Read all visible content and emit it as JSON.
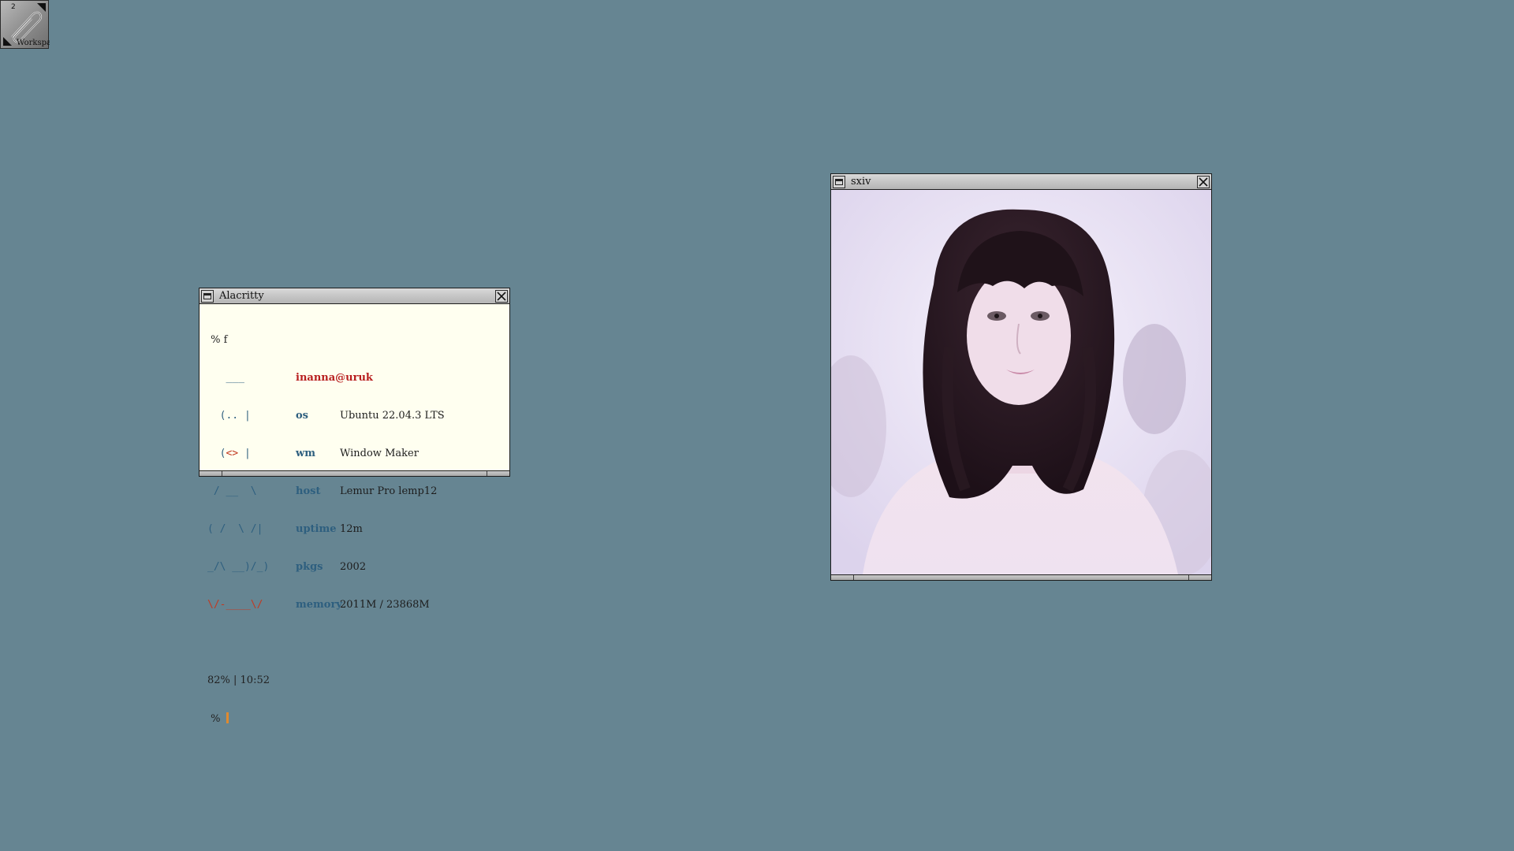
{
  "workspace_clip": {
    "number": "2",
    "name": "Workspace"
  },
  "terminal": {
    "title": "Alacritty",
    "command_line": " % f",
    "userhost": "inanna@uruk",
    "art": {
      "line1": "   ___",
      "line2": "  (.. |",
      "line3_a": "  (",
      "line3_b": "<>",
      "line3_c": " |",
      "line4": " / __  \\",
      "line5": "( /  \\ /|",
      "line6": "_/\\ __)/_)",
      "line7": "\\/-____\\/"
    },
    "info": [
      {
        "key": "os",
        "value": "Ubuntu 22.04.3 LTS"
      },
      {
        "key": "wm",
        "value": "Window Maker"
      },
      {
        "key": "host",
        "value": "Lemur Pro lemp12"
      },
      {
        "key": "uptime",
        "value": "12m"
      },
      {
        "key": "pkgs",
        "value": "2002"
      },
      {
        "key": "memory",
        "value": "2011M / 23868M"
      }
    ],
    "status_line": "82% | 10:52",
    "prompt": " %"
  },
  "viewer": {
    "title": "sxiv"
  },
  "colors": {
    "desktop": "#668592",
    "terminal_bg": "#fffff0",
    "accent_blue": "#2e5f7f",
    "accent_red": "#b81f1f",
    "cursor": "#e08a2e"
  },
  "icons": [
    "paperclip-icon",
    "miniaturize-icon",
    "close-icon"
  ]
}
